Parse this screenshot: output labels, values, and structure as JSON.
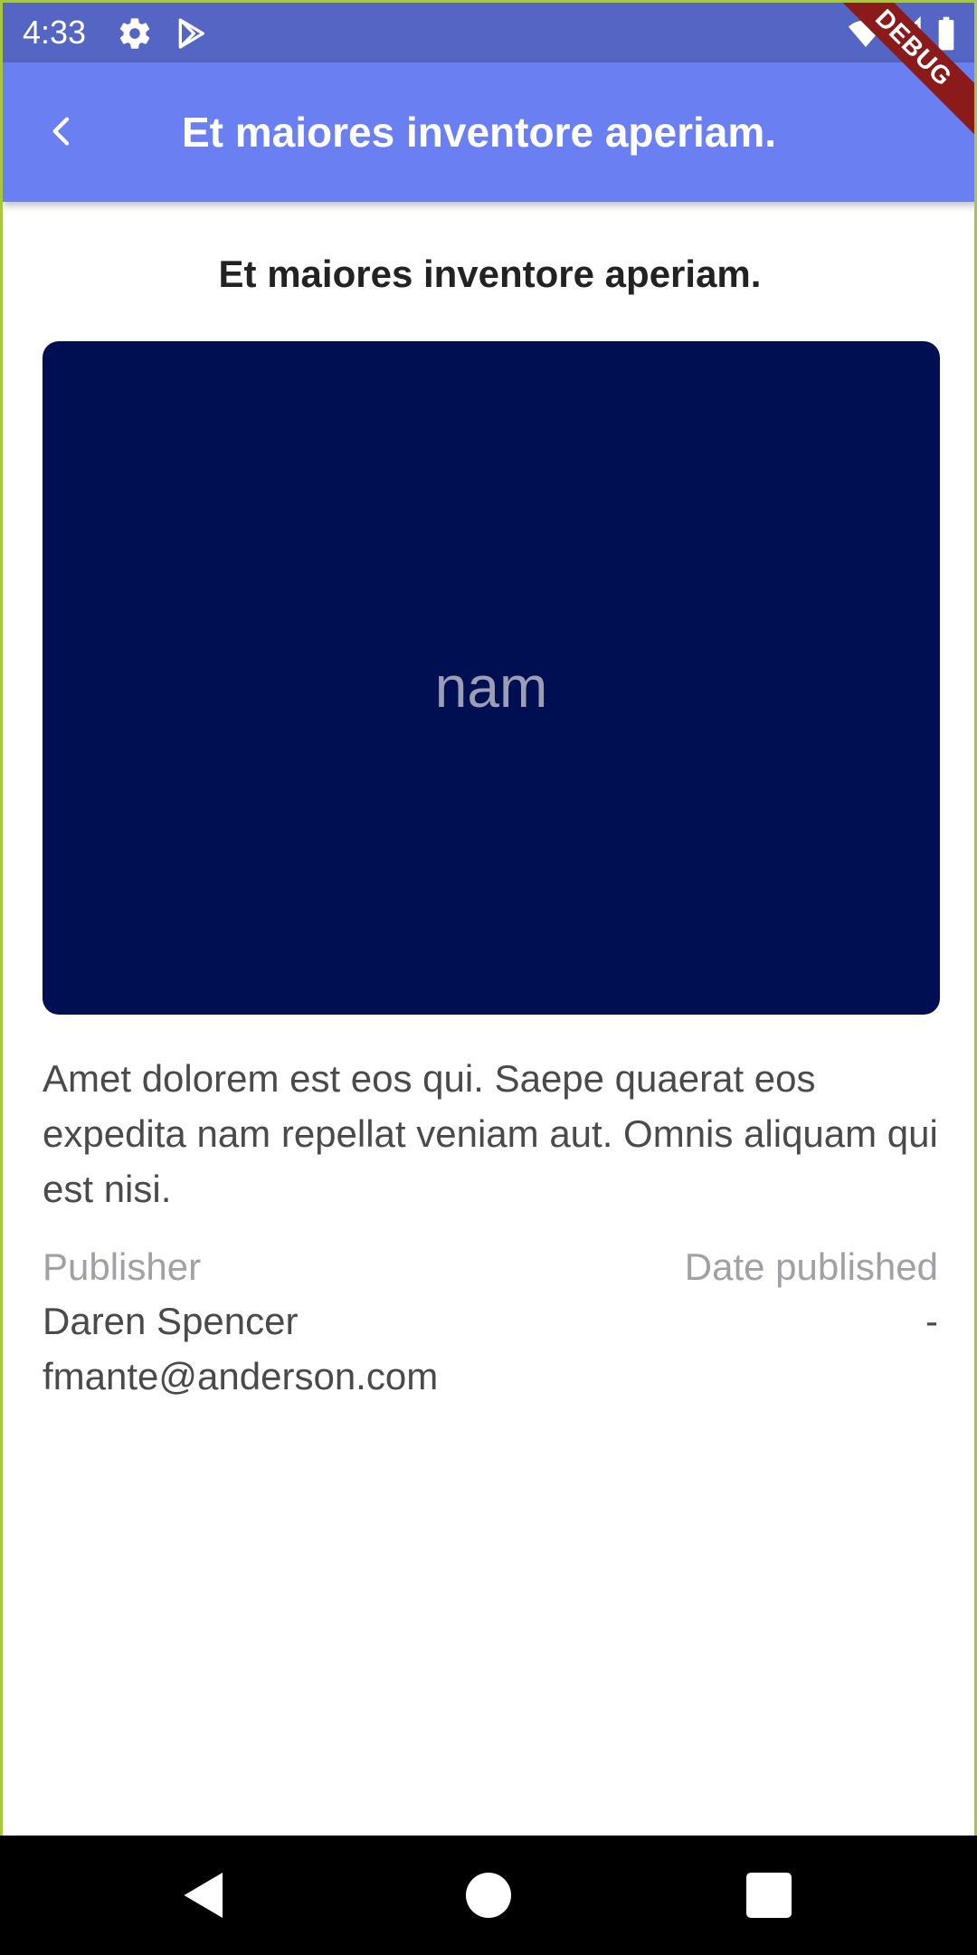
{
  "status_bar": {
    "time": "4:33",
    "icons": [
      "gear-icon",
      "play-store-icon",
      "wifi-icon",
      "signal-icon",
      "battery-icon"
    ]
  },
  "app_bar": {
    "title": "Et maiores inventore aperiam.",
    "back_icon": "chevron-left-icon",
    "debug_label": "DEBUG"
  },
  "article": {
    "heading": "Et maiores inventore aperiam.",
    "image_label": "nam",
    "description": "Amet dolorem est eos qui. Saepe quaerat eos expedita nam repellat veniam aut. Omnis aliquam qui est nisi.",
    "publisher_label": "Publisher",
    "publisher_name": "Daren Spencer",
    "publisher_email": "fmante@anderson.com",
    "date_label": "Date published",
    "date_value": "-"
  },
  "nav_bar": {
    "icons": [
      "back-triangle-icon",
      "home-circle-icon",
      "recents-square-icon"
    ]
  },
  "colors": {
    "status_bar": "#5565c4",
    "app_bar": "#6a7ff2",
    "image_card": "#000f52",
    "debug_ribbon": "#8b1a1a"
  }
}
